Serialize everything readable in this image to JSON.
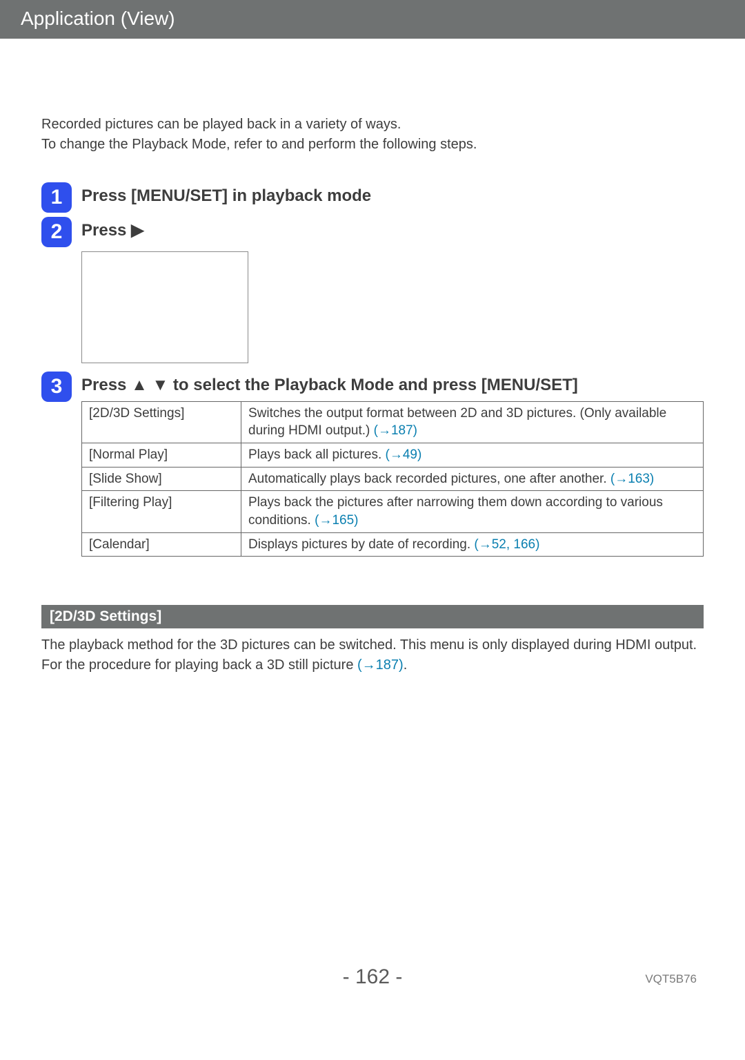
{
  "header": {
    "title": "Application (View)"
  },
  "intro": {
    "line1": "Recorded pictures can be played back in a variety of ways.",
    "line2": "To change the Playback Mode, refer to and perform the following steps."
  },
  "steps": {
    "s1": {
      "num": "1",
      "title": "Press [MENU/SET] in playback mode"
    },
    "s2": {
      "num": "2",
      "title_prefix": "Press ",
      "arrow": "▶"
    },
    "s3": {
      "num": "3",
      "title_prefix": "Press ",
      "up": "▲",
      "down": "▼",
      "title_suffix": " to select the Playback Mode and press [MENU/SET]"
    }
  },
  "table": {
    "rows": [
      {
        "name": "[2D/3D Settings]",
        "desc": "Switches the output format between 2D and 3D pictures. (Only available during HDMI output.) ",
        "link": "(→187)"
      },
      {
        "name": "[Normal Play]",
        "desc": "Plays back all pictures. ",
        "link": "(→49)"
      },
      {
        "name": "[Slide Show]",
        "desc": "Automatically plays back recorded pictures, one after another. ",
        "link": "(→163)"
      },
      {
        "name": "[Filtering Play]",
        "desc": "Plays back the pictures after narrowing them down according to various conditions. ",
        "link": "(→165)"
      },
      {
        "name": "[Calendar]",
        "desc": "Displays pictures by date of recording. ",
        "link": "(→52, 166)"
      }
    ]
  },
  "section": {
    "heading": "[2D/3D Settings]",
    "body_part1": "The playback method for the 3D pictures can be switched. This menu is only displayed during HDMI output. For the procedure for playing back a 3D still picture ",
    "body_link": "(→187)",
    "body_part2": "."
  },
  "footer": {
    "page": "- 162 -",
    "docid": "VQT5B76"
  }
}
